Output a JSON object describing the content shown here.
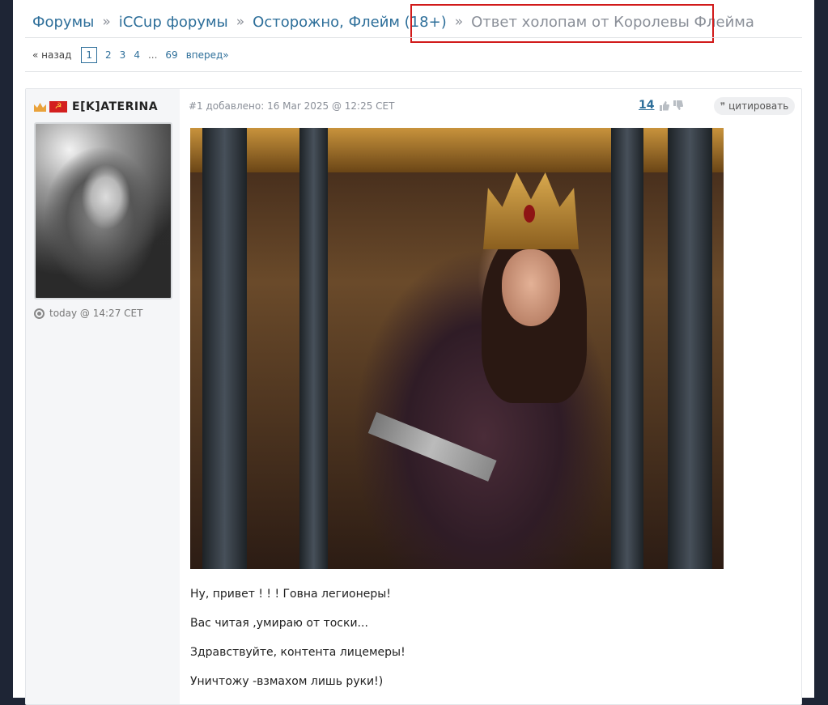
{
  "breadcrumb": {
    "items": [
      "Форумы",
      "iCCup форумы",
      "Осторожно, Флейм (18+)"
    ],
    "separator": "»",
    "current": "Ответ холопам от Королевы Флейма"
  },
  "pagination": {
    "prev_label": "« назад",
    "current_page": "1",
    "pages": [
      "2",
      "3",
      "4"
    ],
    "ellipsis": "...",
    "last_page": "69",
    "next_label": "вперед»"
  },
  "post": {
    "author": {
      "name": "E[K]ATERINA",
      "flag_symbol": "☭",
      "icons": [
        "crown-icon",
        "ussr-flag-icon"
      ]
    },
    "last_online": "today @ 14:27 CET",
    "meta": "#1 добавлено: 16 Mar 2025 @ 12:25 CET",
    "rating": "14",
    "quote_label": "цитировать",
    "quote_icon": "❞",
    "lines": [
      "Ну, привет ! ! ! Говна легионеры!",
      "Вас читая ,умираю от тоски...",
      "Здравствуйте, контента лицемеры!",
      "Уничтожу -взмахом лишь руки!)"
    ]
  },
  "colors": {
    "link": "#2e6f9a",
    "muted": "#8a8f98",
    "highlight_box": "#d11a1a",
    "page_bg": "#1e2535"
  }
}
